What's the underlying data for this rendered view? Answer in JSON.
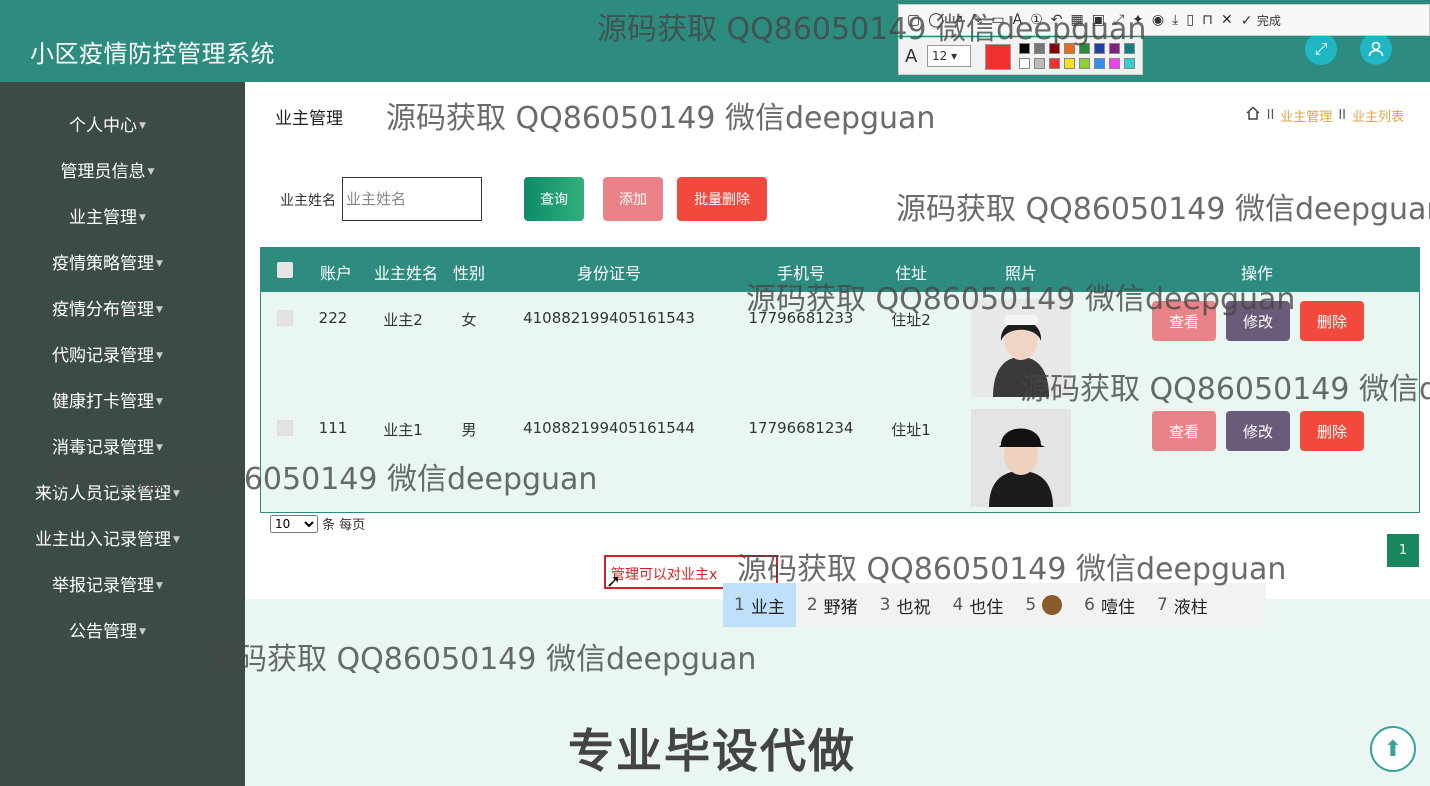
{
  "header": {
    "app_title": "小区疫情防控管理系统"
  },
  "sidebar": {
    "items": [
      {
        "label": "个人中心"
      },
      {
        "label": "管理员信息"
      },
      {
        "label": "业主管理"
      },
      {
        "label": "疫情策略管理"
      },
      {
        "label": "疫情分布管理"
      },
      {
        "label": "代购记录管理"
      },
      {
        "label": "健康打卡管理"
      },
      {
        "label": "消毒记录管理"
      },
      {
        "label": "来访人员记录管理"
      },
      {
        "label": "业主出入记录管理"
      },
      {
        "label": "举报记录管理"
      },
      {
        "label": "公告管理"
      }
    ]
  },
  "main": {
    "page_title": "业主管理",
    "breadcrumb": [
      "业主管理",
      "业主列表"
    ],
    "search": {
      "label": "业主姓名",
      "placeholder": "业主姓名",
      "value": ""
    },
    "buttons": {
      "query": "查询",
      "add": "添加",
      "bulk_delete": "批量删除"
    },
    "table": {
      "headers": [
        "账户",
        "业主姓名",
        "性别",
        "身份证号",
        "手机号",
        "住址",
        "照片",
        "操作"
      ],
      "rows": [
        {
          "account": "222",
          "name": "业主2",
          "gender": "女",
          "id_number": "410882199405161543",
          "phone": "17796681233",
          "address": "住址2"
        },
        {
          "account": "111",
          "name": "业主1",
          "gender": "男",
          "id_number": "410882199405161544",
          "phone": "17796681234",
          "address": "住址1"
        }
      ],
      "row_actions": {
        "view": "查看",
        "edit": "修改",
        "delete": "删除"
      }
    },
    "pagination": {
      "page_size": "10",
      "page_size_suffix": "条 每页",
      "current_page": "1"
    }
  },
  "annotation": {
    "note_text": "管理可以对业主x",
    "ime_candidates": [
      {
        "num": "1",
        "text": "业主"
      },
      {
        "num": "2",
        "text": "野猪"
      },
      {
        "num": "3",
        "text": "也祝"
      },
      {
        "num": "4",
        "text": "也住"
      },
      {
        "num": "5",
        "text": ""
      },
      {
        "num": "6",
        "text": "噎住"
      },
      {
        "num": "7",
        "text": "液柱"
      }
    ],
    "toolbar": {
      "font_size": "12",
      "done_label": "完成"
    },
    "watermark": "源码获取 QQ86050149 微信deepguan",
    "promo": "专业毕设代做"
  },
  "colors": {
    "header": "#2e8b7f",
    "sidebar": "#3d4b48",
    "accent_red": "#f14a3c",
    "accent_pink": "#ea8388",
    "accent_purple": "#6b5b7a"
  }
}
